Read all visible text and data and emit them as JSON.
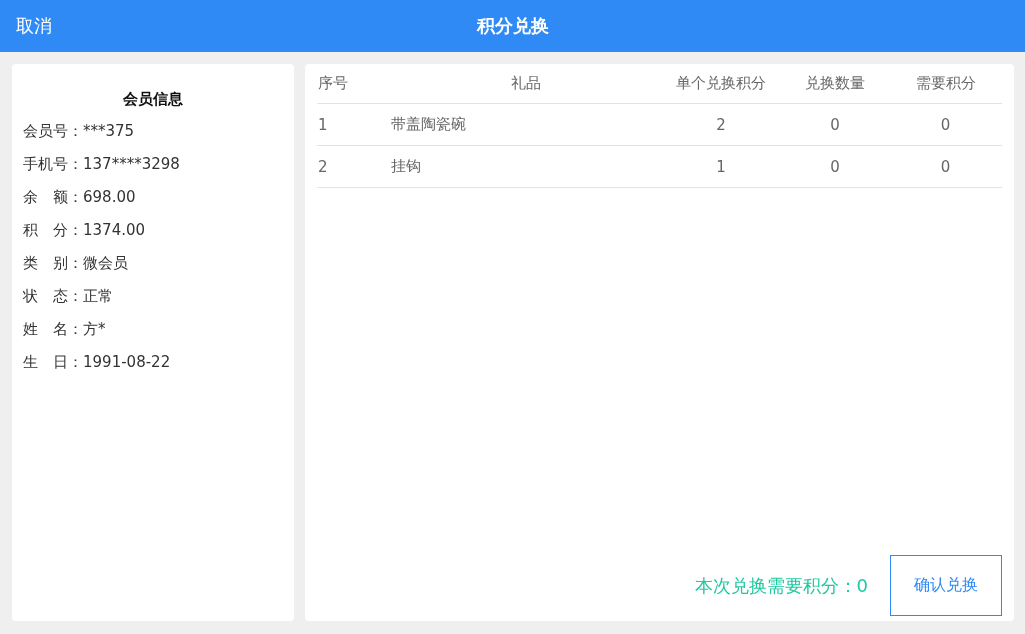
{
  "header": {
    "cancel": "取消",
    "title": "积分兑换"
  },
  "member": {
    "title": "会员信息",
    "lines": [
      "会员号：***375",
      "手机号：137****3298",
      "余　额：698.00",
      "积　分：1374.00",
      "类　别：微会员",
      "状　态：正常",
      "姓　名：方*",
      "生　日：1991-08-22"
    ]
  },
  "table": {
    "columns": [
      "序号",
      "礼品",
      "单个兑换积分",
      "兑换数量",
      "需要积分"
    ],
    "rows": [
      [
        "1",
        "带盖陶瓷碗",
        "2",
        "0",
        "0"
      ],
      [
        "2",
        "挂钩",
        "1",
        "0",
        "0"
      ]
    ]
  },
  "footer": {
    "total": "本次兑换需要积分：0",
    "confirm": "确认兑换"
  }
}
